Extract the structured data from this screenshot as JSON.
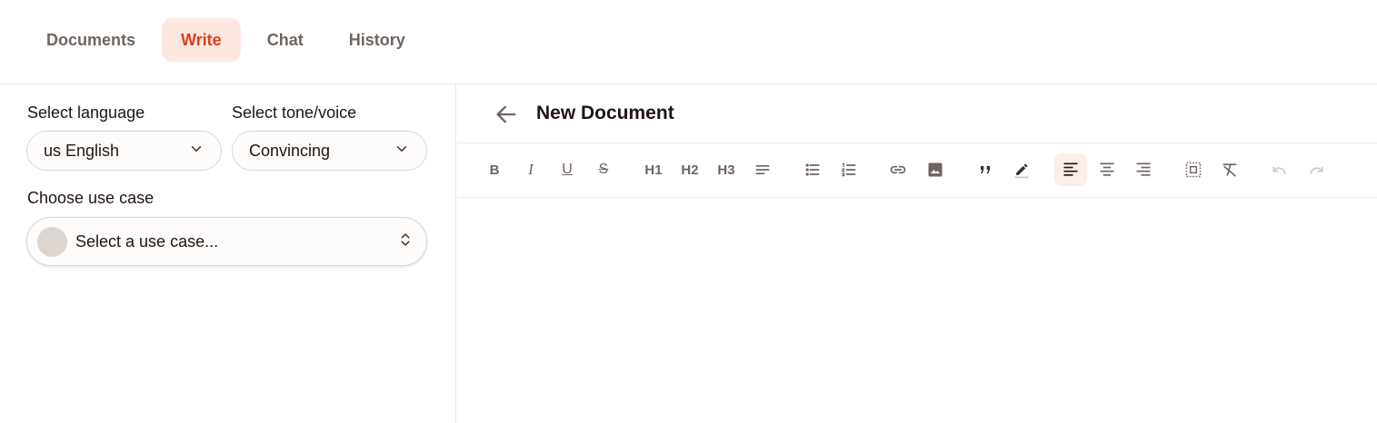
{
  "tabs": [
    {
      "label": "Documents"
    },
    {
      "label": "Write"
    },
    {
      "label": "Chat"
    },
    {
      "label": "History"
    }
  ],
  "active_tab": "Write",
  "colors": {
    "accent": "#d9401f",
    "accent_bg": "#fde7e1",
    "muted": "#6f6460"
  },
  "left": {
    "language_label": "Select language",
    "language_value": "us English",
    "tone_label": "Select tone/voice",
    "tone_value": "Convincing",
    "usecase_label": "Choose use case",
    "usecase_placeholder": "Select a use case..."
  },
  "document": {
    "title": "New Document",
    "toolbar": {
      "h1": "H1",
      "h2": "H2",
      "h3": "H3",
      "bold": "B",
      "italic": "I",
      "underline": "U",
      "strike": "S"
    }
  }
}
